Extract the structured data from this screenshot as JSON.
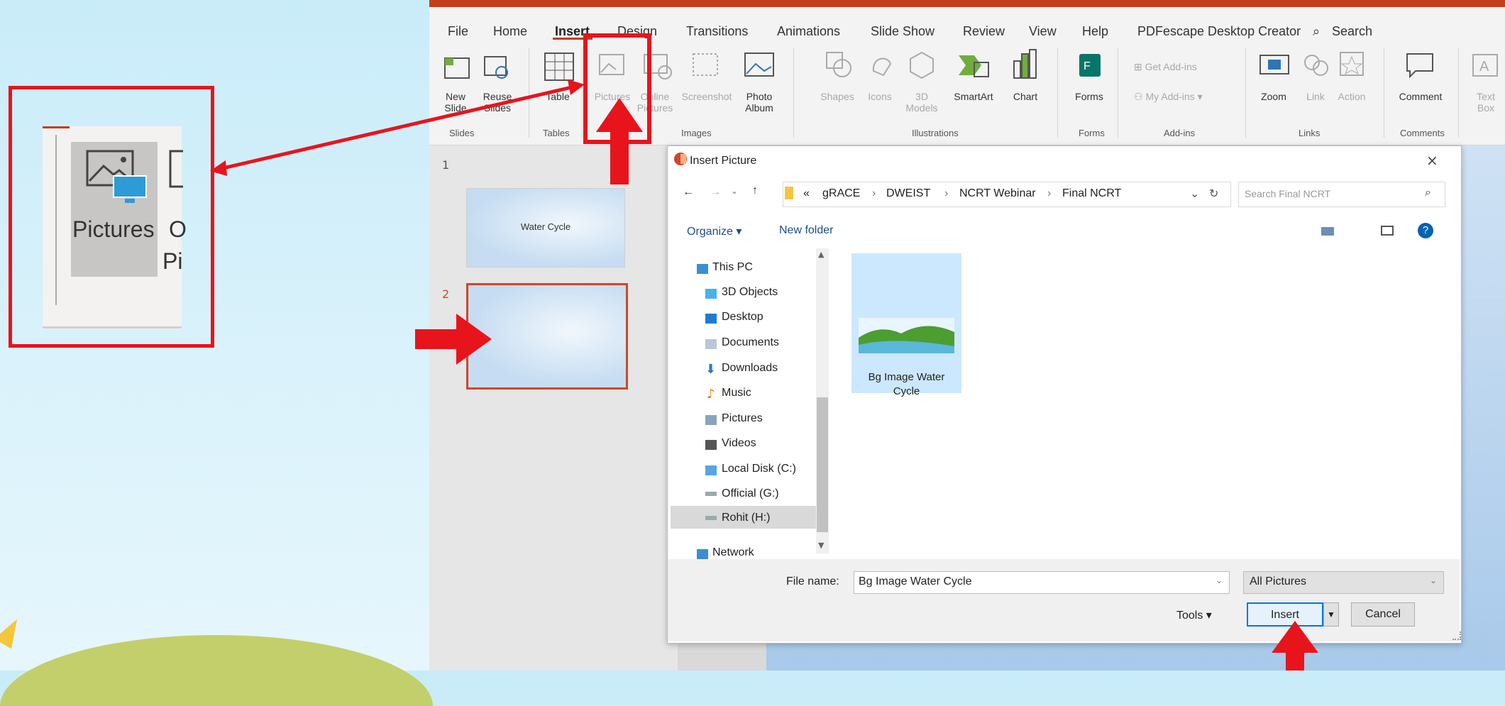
{
  "ribbon": {
    "tabs": [
      "File",
      "Home",
      "Insert",
      "Design",
      "Transitions",
      "Animations",
      "Slide Show",
      "Review",
      "View",
      "Help",
      "PDFescape Desktop Creator",
      "Search"
    ],
    "active_tab": "Insert",
    "buttons": {
      "new_slide": [
        "New",
        "Slide"
      ],
      "reuse_slides": [
        "Reuse",
        "Slides"
      ],
      "table": [
        "Table"
      ],
      "pictures": "Pictures",
      "online_pictures": [
        "Online",
        "Pictures"
      ],
      "screenshot": "Screenshot",
      "photo_album": [
        "Photo",
        "Album"
      ],
      "shapes": "Shapes",
      "icons": "Icons",
      "models": [
        "3D",
        "Models"
      ],
      "smartart": "SmartArt",
      "chart": "Chart",
      "forms": "Forms",
      "get_addins": "Get Add-ins",
      "my_addins": "My Add-ins",
      "zoom": "Zoom",
      "link": "Link",
      "action": "Action",
      "comment": "Comment",
      "text_box": [
        "Text",
        "Box"
      ]
    },
    "groups": [
      "Slides",
      "Tables",
      "Images",
      "Illustrations",
      "Forms",
      "Add-ins",
      "Links",
      "Comments"
    ]
  },
  "zoom_callout": {
    "pictures": "Pictures",
    "online_c": "O",
    "online_pi": "Pi"
  },
  "slides": [
    {
      "number": "1",
      "title": "Water Cycle"
    },
    {
      "number": "2",
      "title": ""
    }
  ],
  "dialog": {
    "title": "Insert Picture",
    "close": "×",
    "breadcrumb": [
      "«",
      "gRACE",
      "DWEIST",
      "NCRT Webinar",
      "Final NCRT"
    ],
    "search_placeholder": "Search Final NCRT",
    "organize": "Organize ▾",
    "new_folder": "New folder",
    "nav_items": [
      "This PC",
      "3D Objects",
      "Desktop",
      "Documents",
      "Downloads",
      "Music",
      "Pictures",
      "Videos",
      "Local Disk (C:)",
      "Official (G:)",
      "Rohit (H:)",
      "Network"
    ],
    "file": {
      "name_line1": "Bg Image Water",
      "name_line2": "Cycle"
    },
    "file_name_label": "File name:",
    "file_name_value": "Bg Image Water Cycle",
    "file_type": "All Pictures",
    "tools": "Tools",
    "insert": "Insert",
    "cancel": "Cancel"
  },
  "colors": {
    "accent": "#c43e1c",
    "annotation": "#e8141c",
    "selection": "#cce8ff"
  }
}
